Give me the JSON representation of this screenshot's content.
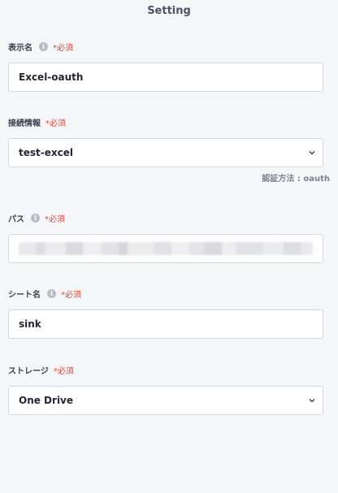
{
  "header": {
    "title": "Setting"
  },
  "fields": {
    "display_name": {
      "label": "表示名",
      "required": "*必須",
      "value": "Excel-oauth"
    },
    "connection": {
      "label": "接続情報",
      "required": "*必須",
      "value": "test-excel",
      "helper": "認証方法 : oauth"
    },
    "path": {
      "label": "パス",
      "required": "*必須"
    },
    "sheet_name": {
      "label": "シート名",
      "required": "*必須",
      "value": "sink"
    },
    "storage": {
      "label": "ストレージ",
      "required": "*必須",
      "value": "One Drive"
    }
  },
  "icons": {
    "info": "info-icon",
    "chevron": "chevron-down-icon"
  },
  "colors": {
    "required": "#e2463d",
    "background": "#f5f6f8",
    "border": "#d5d8de"
  }
}
